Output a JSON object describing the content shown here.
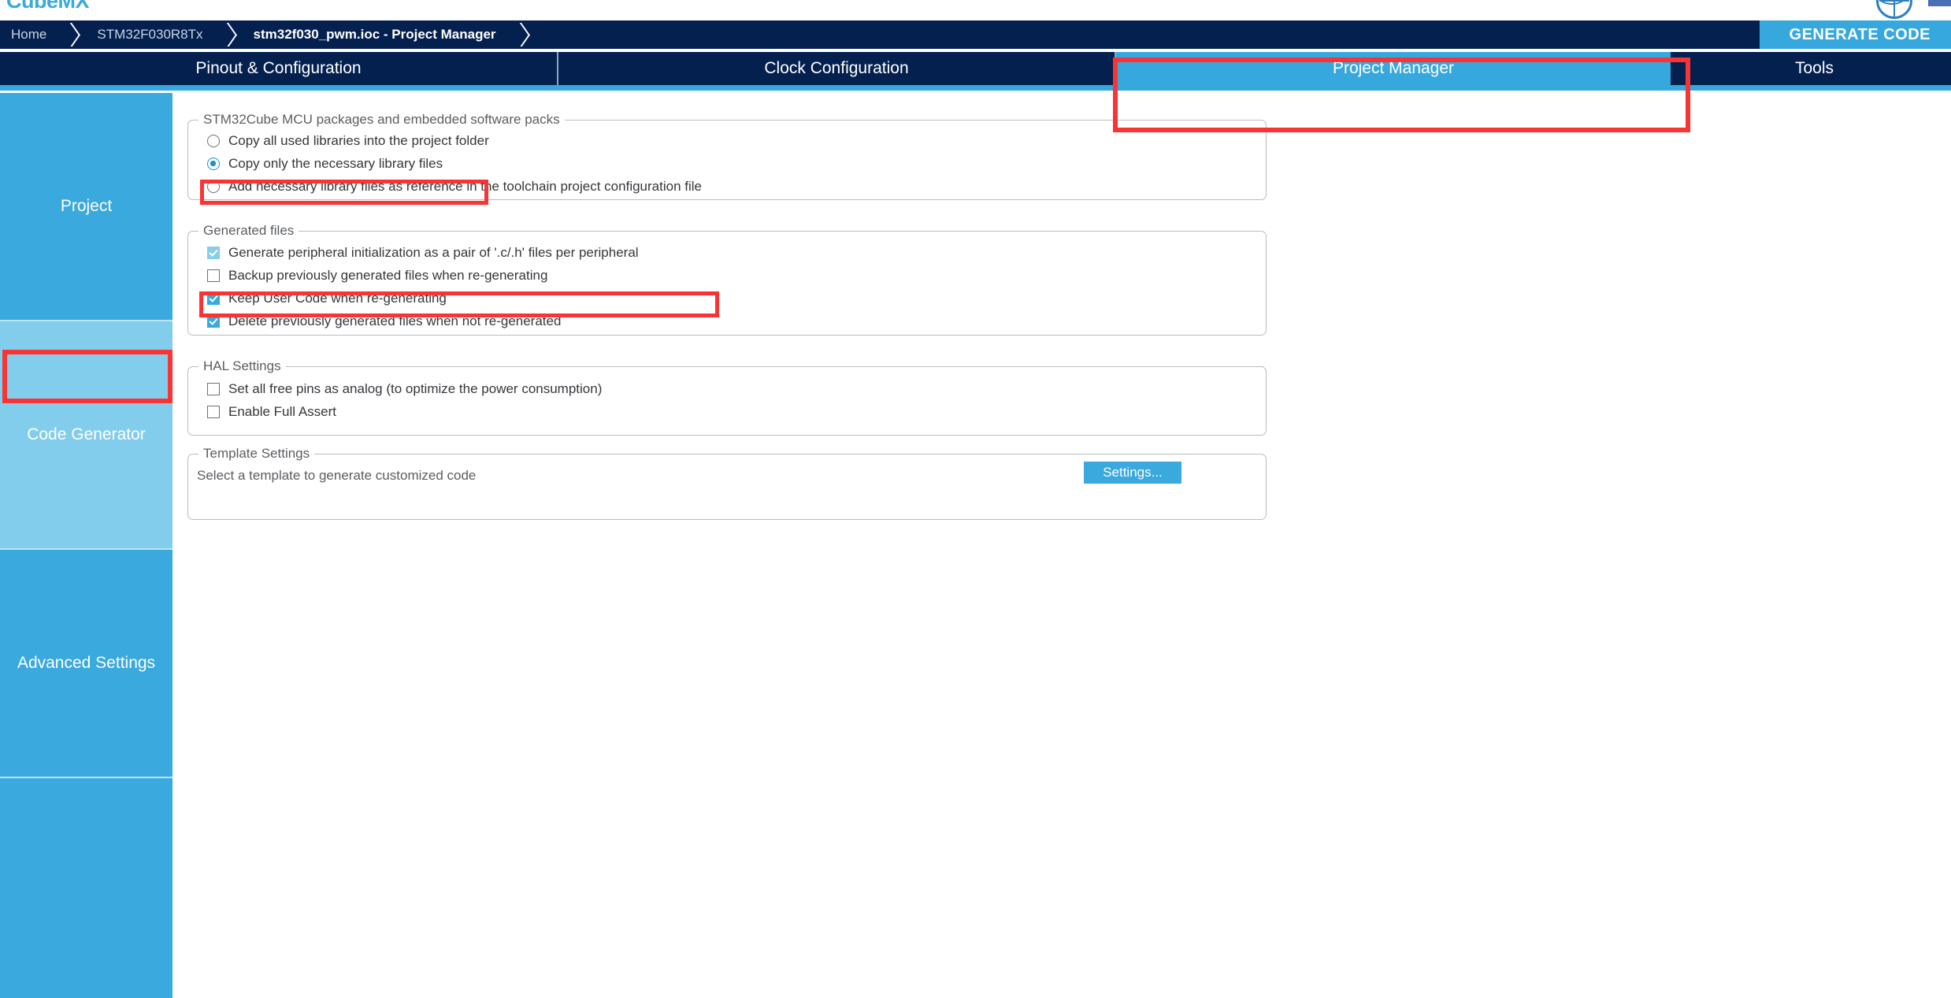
{
  "app": {
    "brand": "CubeMX",
    "globe_icon": "globe-icon",
    "corner_button": "window-corner-button"
  },
  "breadcrumb": {
    "items": [
      {
        "label": "Home",
        "active": false
      },
      {
        "label": "STM32F030R8Tx",
        "active": false
      },
      {
        "label": "stm32f030_pwm.ioc - Project Manager",
        "active": true
      }
    ]
  },
  "header": {
    "generate_code_label": "GENERATE CODE"
  },
  "tabs": [
    {
      "label": "Pinout & Configuration",
      "selected": false
    },
    {
      "label": "Clock Configuration",
      "selected": false
    },
    {
      "label": "Project Manager",
      "selected": true
    },
    {
      "label": "Tools",
      "selected": false
    }
  ],
  "sidebar": {
    "items": [
      {
        "label": "Project",
        "selected": false
      },
      {
        "label": "Code Generator",
        "selected": true
      },
      {
        "label": "Advanced Settings",
        "selected": false
      },
      {
        "label": "",
        "selected": false
      }
    ]
  },
  "groups": {
    "mcu_packages": {
      "title": "STM32Cube MCU packages and embedded software packs",
      "options": [
        {
          "label": "Copy all used libraries into the project folder",
          "checked": false
        },
        {
          "label": "Copy only the necessary library files",
          "checked": true
        },
        {
          "label": "Add necessary library files as reference in the toolchain project configuration file",
          "checked": false
        }
      ]
    },
    "generated_files": {
      "title": "Generated files",
      "options": [
        {
          "label": "Generate peripheral initialization as a pair of '.c/.h' files per peripheral",
          "checked": true,
          "dim": true
        },
        {
          "label": "Backup previously generated files when re-generating",
          "checked": false,
          "dim": false
        },
        {
          "label": "Keep User Code when re-generating",
          "checked": true,
          "dim": false
        },
        {
          "label": "Delete previously generated files when not re-generated",
          "checked": true,
          "dim": false
        }
      ]
    },
    "hal_settings": {
      "title": "HAL Settings",
      "options": [
        {
          "label": "Set all free pins as analog (to optimize the power consumption)",
          "checked": false
        },
        {
          "label": "Enable Full Assert",
          "checked": false
        }
      ]
    },
    "template_settings": {
      "title": "Template Settings",
      "description": "Select a template to generate customized code",
      "settings_button": "Settings..."
    }
  },
  "annotations": {
    "color": "#fa3434",
    "boxes": [
      {
        "name": "project-manager-tab-highlight"
      },
      {
        "name": "copy-only-necessary-library-files-highlight"
      },
      {
        "name": "generate-peripheral-init-pair-highlight"
      },
      {
        "name": "code-generator-sidebar-highlight"
      }
    ]
  }
}
